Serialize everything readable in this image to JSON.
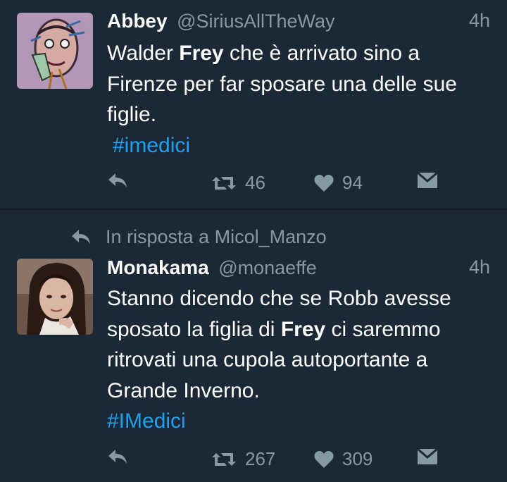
{
  "tweets": [
    {
      "name": "Abbey",
      "handle": "@SiriusAllTheWay",
      "time": "4h",
      "text_parts": [
        "Walder ",
        "Frey",
        " che è arrivato sino a Firenze per far sposare una delle sue figlie."
      ],
      "hashtag": "#imedici",
      "retweets": "46",
      "likes": "94",
      "avatar_icon": "sketched-face-avatar"
    },
    {
      "reply_context": "In risposta a Micol_Manzo",
      "name": "Monakama",
      "handle": "@monaeffe",
      "time": "4h",
      "text_parts": [
        "Stanno dicendo che se Robb avesse sposato la figlia di ",
        "Frey",
        " ci saremmo ritrovati una cupola autoportante a Grande Inverno."
      ],
      "hashtag": "#IMedici",
      "retweets": "267",
      "likes": "309",
      "avatar_icon": "woman-photo-avatar"
    }
  ],
  "colors": {
    "background": "#1b2836",
    "divider": "#0f1720",
    "text": "#ffffff",
    "muted": "#8899a6",
    "link": "#1da1f2"
  },
  "icons": [
    "reply-icon",
    "retweet-icon",
    "heart-icon",
    "direct-message-icon"
  ]
}
